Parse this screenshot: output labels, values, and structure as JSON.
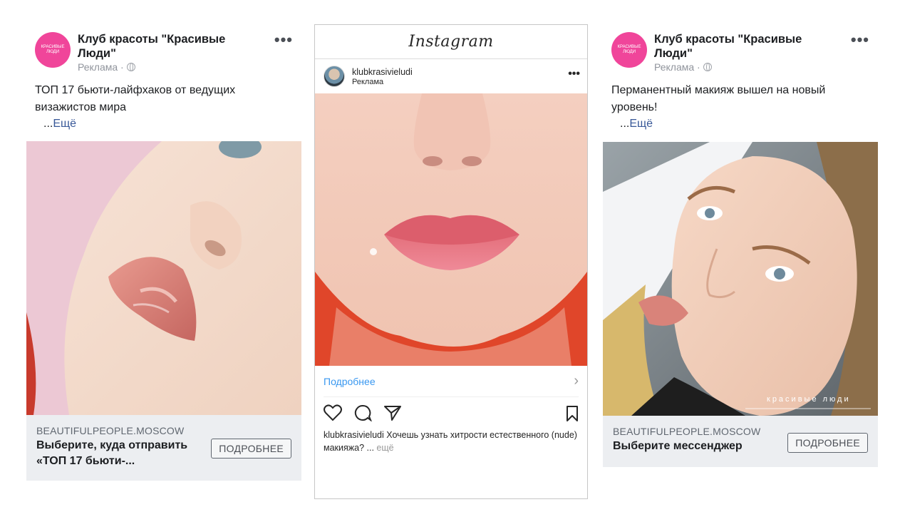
{
  "ad_left": {
    "page_name": "Клуб красоты \"Красивые Люди\"",
    "sponsored": "Реклама ·",
    "avatar_text": "КРАСИВЫЕ ЛЮДИ",
    "text": "ТОП 17 бьюти-лайфхаков от ведущих визажистов мира",
    "more_dots": "...",
    "more_link": "Ещё",
    "domain": "BEAUTIFULPEOPLE.MOSCOW",
    "cta_title": "Выберите, куда отправить «ТОП 17 бьюти-...",
    "cta_button": "ПОДРОБНЕЕ"
  },
  "ad_instagram": {
    "logo": "Instagram",
    "username": "klubkrasivieludi",
    "sponsored": "Реклама",
    "learn_more": "Подробнее",
    "caption_user": "klubkrasivieludi",
    "caption_text": "Хочешь узнать хитрости естественного (nude) макияжа? ...",
    "caption_more": "ещё"
  },
  "ad_right": {
    "page_name": "Клуб красоты \"Красивые Люди\"",
    "sponsored": "Реклама ·",
    "avatar_text": "КРАСИВЫЕ ЛЮДИ",
    "text": "Перманентный макияж вышел на новый уровень!",
    "more_dots": "...",
    "more_link": "Ещё",
    "watermark": "красивые люди",
    "domain": "BEAUTIFULPEOPLE.MOSCOW",
    "cta_title": "Выберите мессенджер",
    "cta_button": "ПОДРОБНЕЕ"
  },
  "colors": {
    "avatar_pink": "#f0459a",
    "fb_link": "#385898",
    "ig_link": "#3897f0",
    "footer_bg": "#eceef1"
  },
  "icons": [
    "globe-icon",
    "more-icon",
    "heart-icon",
    "comment-icon",
    "share-icon",
    "bookmark-icon",
    "chevron-right-icon"
  ]
}
